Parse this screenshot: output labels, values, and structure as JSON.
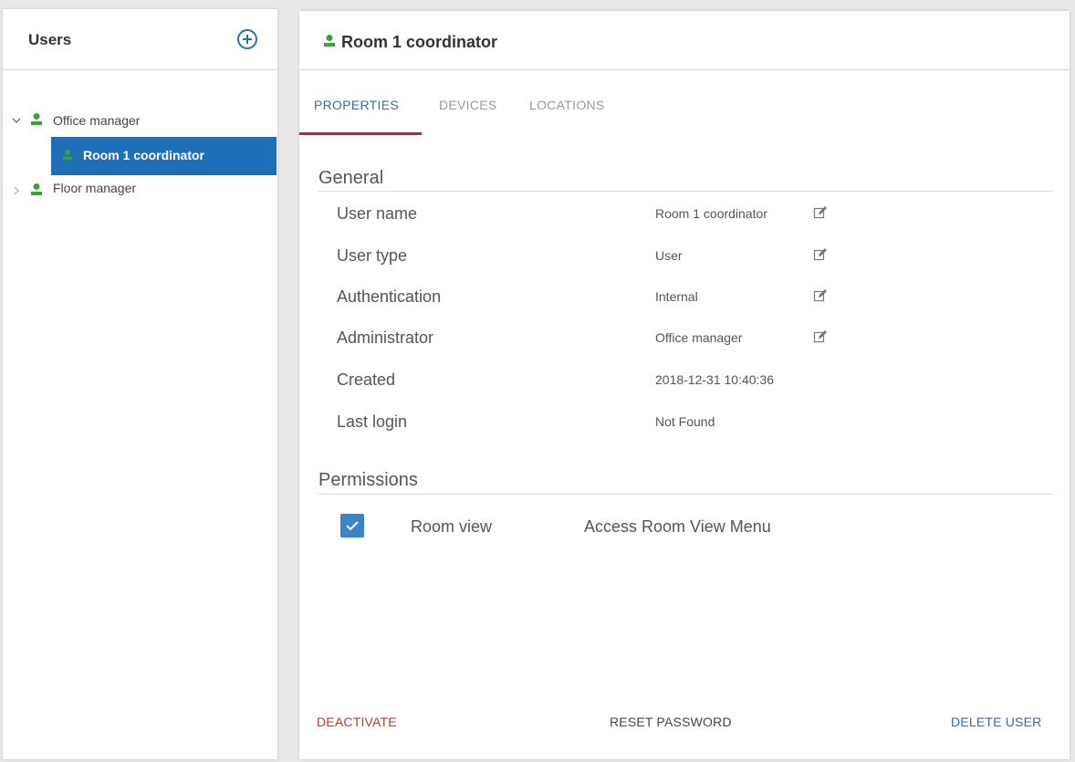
{
  "sidebar": {
    "title": "Users",
    "tree": [
      {
        "label": "Office manager",
        "expanded": true
      },
      {
        "label": "Room 1 coordinator",
        "selected": true
      },
      {
        "label": "Floor manager",
        "expanded": false
      }
    ]
  },
  "detail": {
    "title": "Room 1 coordinator",
    "tabs": [
      "PROPERTIES",
      "DEVICES",
      "LOCATIONS"
    ],
    "general": {
      "heading": "General",
      "rows": [
        {
          "label": "User name",
          "value": "Room 1 coordinator",
          "editable": true
        },
        {
          "label": "User type",
          "value": "User",
          "editable": true
        },
        {
          "label": "Authentication",
          "value": "Internal",
          "editable": true
        },
        {
          "label": "Administrator",
          "value": "Office manager",
          "editable": true
        },
        {
          "label": "Created",
          "value": "2018-12-31 10:40:36",
          "editable": false
        },
        {
          "label": "Last login",
          "value": "Not Found",
          "editable": false
        }
      ]
    },
    "permissions": {
      "heading": "Permissions",
      "items": [
        {
          "name": "Room view",
          "description": "Access Room View Menu",
          "checked": true
        }
      ]
    },
    "actions": {
      "deactivate": "DEACTIVATE",
      "reset_password": "RESET PASSWORD",
      "delete_user": "DELETE USER"
    }
  },
  "colors": {
    "user_icon": "#3aa335",
    "accent_blue": "#1e6fb7",
    "tab_underline": "#b5283a",
    "deactivate": "#c0392b",
    "link_blue": "#2f6fa6"
  },
  "icons": {
    "add": "plus-circle-icon",
    "user": "user-icon",
    "edit": "edit-icon",
    "expand": "chevron-down-icon",
    "collapse": "chevron-right-icon",
    "check": "check-icon"
  }
}
